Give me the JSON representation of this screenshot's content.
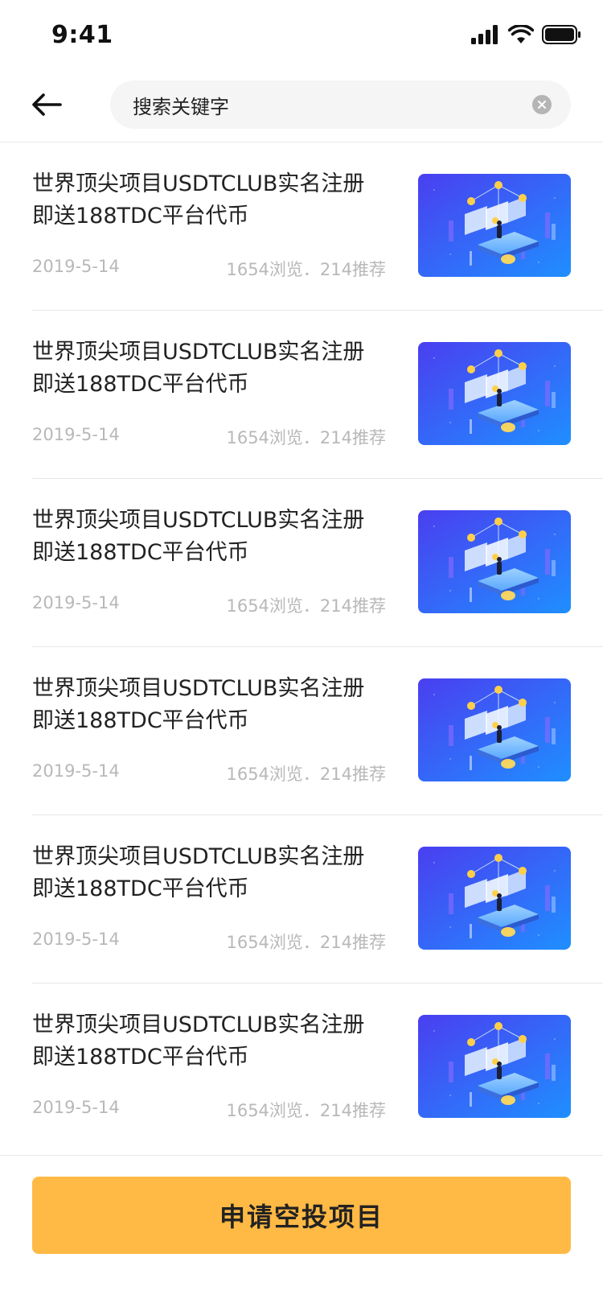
{
  "status_bar": {
    "time": "9:41"
  },
  "header": {
    "search": {
      "value": "搜索关键字"
    }
  },
  "list": {
    "items": [
      {
        "title": "世界顶尖项目USDTCLUB实名注册即送188TDC平台代币",
        "date": "2019-5-14",
        "stats": "1654浏览．214推荐"
      },
      {
        "title": "世界顶尖项目USDTCLUB实名注册即送188TDC平台代币",
        "date": "2019-5-14",
        "stats": "1654浏览．214推荐"
      },
      {
        "title": "世界顶尖项目USDTCLUB实名注册即送188TDC平台代币",
        "date": "2019-5-14",
        "stats": "1654浏览．214推荐"
      },
      {
        "title": "世界顶尖项目USDTCLUB实名注册即送188TDC平台代币",
        "date": "2019-5-14",
        "stats": "1654浏览．214推荐"
      },
      {
        "title": "世界顶尖项目USDTCLUB实名注册即送188TDC平台代币",
        "date": "2019-5-14",
        "stats": "1654浏览．214推荐"
      },
      {
        "title": "世界顶尖项目USDTCLUB实名注册即送188TDC平台代币",
        "date": "2019-5-14",
        "stats": "1654浏览．214推荐"
      }
    ]
  },
  "footer": {
    "apply_label": "申请空投项目"
  },
  "icons": {
    "back": "arrow-left-icon",
    "clear": "clear-circle-icon",
    "signal": "signal-icon",
    "wifi": "wifi-icon",
    "battery": "battery-icon",
    "thumbnail": "isometric-blockchain-illustration"
  },
  "colors": {
    "accent": "#ffb945",
    "thumbnail_gradient_start": "#4a3ff0",
    "thumbnail_gradient_end": "#1f8fff",
    "meta_text": "#b8b8b8"
  }
}
